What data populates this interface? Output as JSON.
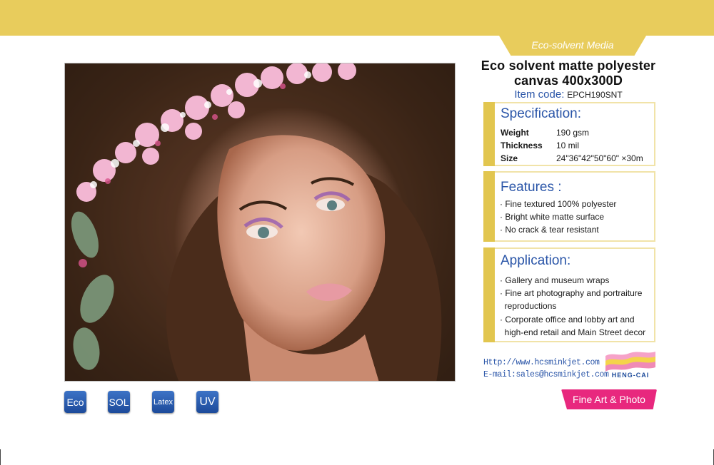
{
  "category_tab": "Eco-solvent Media",
  "product": {
    "title_line1": "Eco solvent matte polyester",
    "title_line2": "canvas 400x300D",
    "item_code_label": "Item code:",
    "item_code_value": "EPCH190SNT"
  },
  "specification": {
    "heading": "Specification:",
    "rows": [
      {
        "label": "Weight",
        "value": "190 gsm"
      },
      {
        "label": "Thickness",
        "value": "10 mil"
      },
      {
        "label": "Size",
        "value": "24\"36\"42\"50\"60\" ×30m"
      }
    ]
  },
  "features": {
    "heading": "Features :",
    "items": [
      "· Fine textured 100% polyester",
      "· Bright white matte surface",
      "· No crack & tear resistant"
    ]
  },
  "application": {
    "heading": "Application:",
    "lines": [
      "· Gallery and museum wraps",
      "· Fine art photography and portraiture",
      "  reproductions",
      "· Corporate office and lobby art and",
      "  high-end retail and Main Street decor"
    ]
  },
  "contact": {
    "web": "Http://www.hcsminkjet.com",
    "email": "E-mail:sales@hcsminkjet.com"
  },
  "logo": {
    "name": "HENG-CAI",
    "colors": [
      "#f6a2c8",
      "#f4d44a",
      "#f08ab6"
    ]
  },
  "ink_badges": [
    "Eco",
    "SOL",
    "Latex",
    "UV"
  ],
  "category_button": "Fine Art & Photo",
  "colors": {
    "band": "#e8cc5c",
    "accent_blue": "#2a55a8",
    "magenta": "#e8287e",
    "badge_blue": "#1c4a9a"
  }
}
